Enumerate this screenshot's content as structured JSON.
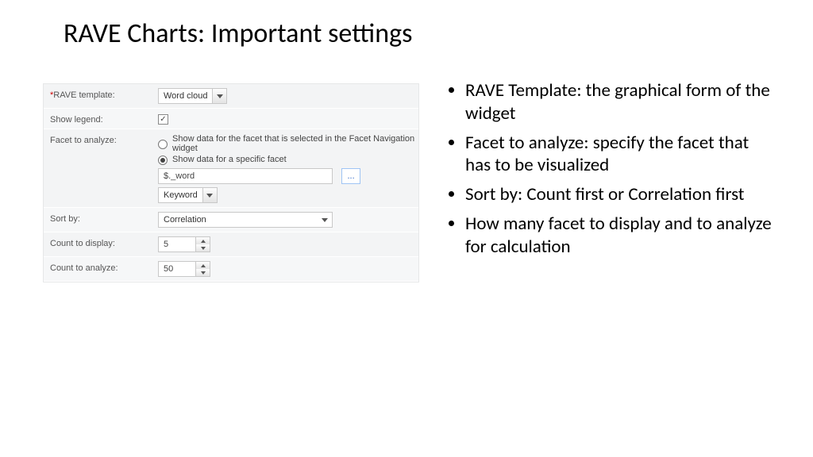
{
  "title": "RAVE Charts: Important settings",
  "form": {
    "rave_template": {
      "label": "RAVE template:",
      "value": "Word cloud"
    },
    "show_legend": {
      "label": "Show legend:",
      "checked": true
    },
    "facet": {
      "label": "Facet to analyze:",
      "option1": "Show data for the facet that is selected in the Facet Navigation widget",
      "option2": "Show data for a specific facet",
      "selectedOption": 2,
      "textValue": "$._word",
      "typeValue": "Keyword",
      "moreLabel": "..."
    },
    "sort_by": {
      "label": "Sort by:",
      "value": "Correlation"
    },
    "count_display": {
      "label": "Count to display:",
      "value": "5"
    },
    "count_analyze": {
      "label": "Count to analyze:",
      "value": "50"
    }
  },
  "bullets": [
    "RAVE Template: the graphical form of the widget",
    "Facet to analyze: specify the facet that has to be visualized",
    "Sort by: Count first or Correlation first",
    "How many facet to display and to analyze for calculation"
  ]
}
